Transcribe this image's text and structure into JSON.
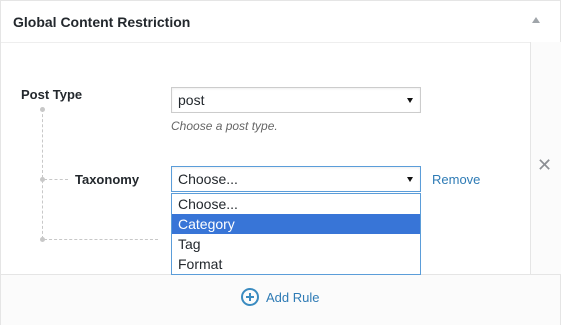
{
  "panel": {
    "title": "Global Content Restriction"
  },
  "rule": {
    "post_type_label": "Post Type",
    "post_type_value": "post",
    "post_type_help": "Choose a post type.",
    "taxonomy_label": "Taxonomy",
    "taxonomy_value": "Choose...",
    "remove_label": "Remove",
    "taxonomy_options": [
      "Choose...",
      "Category",
      "Tag",
      "Format"
    ],
    "highlighted_option": "Category"
  },
  "footer": {
    "add_rule_label": "Add Rule"
  },
  "icons": {
    "collapse": "triangle-up-icon",
    "delete_rule": "close-icon",
    "add": "plus-circle-icon",
    "select_caret": "caret-down-icon"
  },
  "colors": {
    "link": "#2e7bb5",
    "focus_border": "#5b9dd9",
    "highlight": "#3875d7"
  }
}
